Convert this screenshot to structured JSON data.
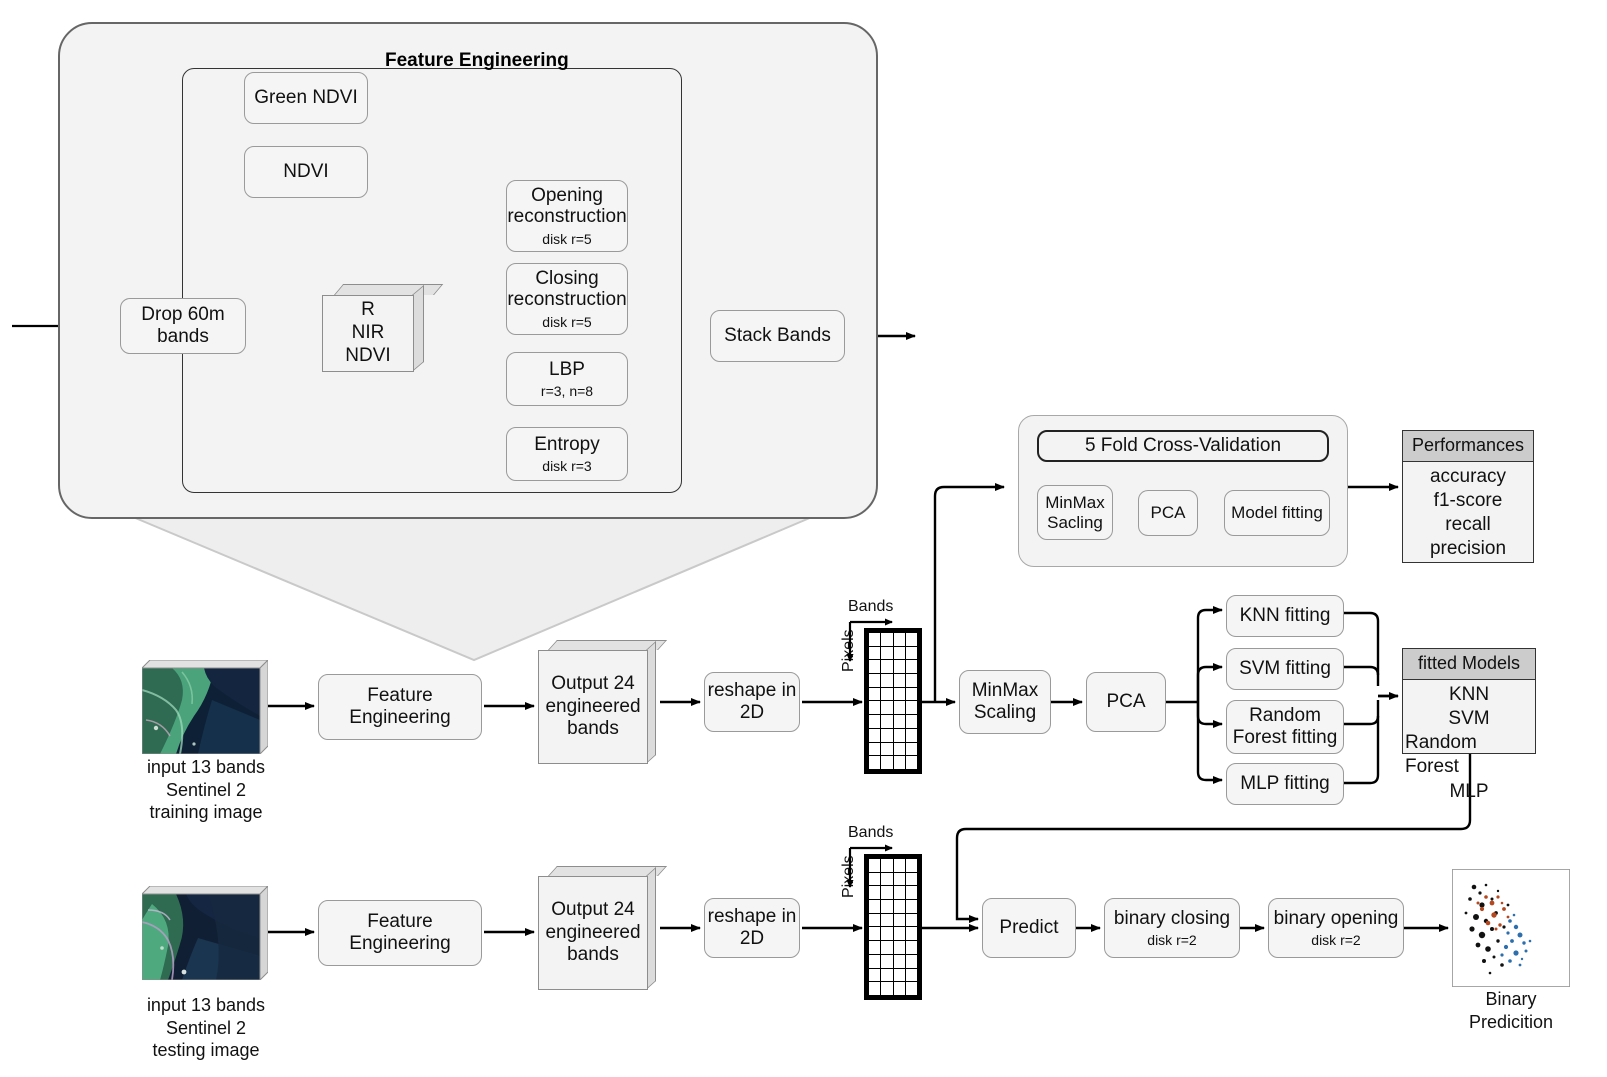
{
  "diagram": {
    "title": "Feature Engineering",
    "feature_engineering": {
      "group_title": "Feature Engineering",
      "nodes": {
        "drop60": {
          "line1": "Drop 60m",
          "line2": "bands"
        },
        "green_ndvi": {
          "label": "Green NDVI"
        },
        "ndvi": {
          "label": "NDVI"
        },
        "cube_rnirndvi": {
          "line1": "R",
          "line2": "NIR",
          "line3": "NDVI"
        },
        "opening": {
          "line1": "Opening",
          "line2": "reconstruction",
          "sub": "disk r=5"
        },
        "closing": {
          "line1": "Closing",
          "line2": "reconstruction",
          "sub": "disk r=5"
        },
        "lbp": {
          "line1": "LBP",
          "sub": "r=3, n=8"
        },
        "entropy": {
          "line1": "Entropy",
          "sub": "disk r=3"
        },
        "stack": {
          "label": "Stack Bands"
        }
      }
    },
    "cross_validation": {
      "header": "5 Fold Cross-Validation",
      "minmax": {
        "line1": "MinMax",
        "line2": "Sacling"
      },
      "pca": {
        "label": "PCA"
      },
      "model_fitting": {
        "label": "Model fitting"
      }
    },
    "performances": {
      "header": "Performances",
      "metrics": [
        "accuracy",
        "f1-score",
        "recall",
        "precision"
      ]
    },
    "fitted_models": {
      "header": "fitted Models",
      "models": [
        "KNN",
        "SVM",
        "Random Forest",
        "MLP"
      ]
    },
    "fitting_nodes": {
      "knn": {
        "label": "KNN fitting"
      },
      "svm": {
        "label": "SVM fitting"
      },
      "rf": {
        "line1": "Random",
        "line2": "Forest fitting"
      },
      "mlp": {
        "label": "MLP fitting"
      }
    },
    "training_row": {
      "input_caption": "input 13 bands\nSentinel 2\ntraining image",
      "feature_engineering": {
        "line1": "Feature",
        "line2": "Engineering"
      },
      "output": {
        "line1": "Output 24",
        "line2": "engineered",
        "line3": "bands"
      },
      "reshape": {
        "line1": "reshape in",
        "line2": "2D"
      },
      "matrix": {
        "bands_label": "Bands",
        "pixels_label": "Pixels",
        "cols": 4,
        "rows": 10
      },
      "minmax": {
        "line1": "MinMax",
        "line2": "Scaling"
      },
      "pca": {
        "label": "PCA"
      }
    },
    "testing_row": {
      "input_caption": "input 13 bands\nSentinel 2\ntesting image",
      "feature_engineering": {
        "line1": "Feature",
        "line2": "Engineering"
      },
      "output": {
        "line1": "Output 24",
        "line2": "engineered",
        "line3": "bands"
      },
      "reshape": {
        "line1": "reshape in",
        "line2": "2D"
      },
      "matrix": {
        "bands_label": "Bands",
        "pixels_label": "Pixels",
        "cols": 4,
        "rows": 10
      },
      "predict": {
        "label": "Predict"
      },
      "binary_closing": {
        "line1": "binary closing",
        "sub": "disk r=2"
      },
      "binary_opening": {
        "line1": "binary opening",
        "sub": "disk r=2"
      },
      "result_caption": "Binary\nPredicition"
    },
    "colors": {
      "node_fill": "#f5f5f5",
      "node_stroke": "#9a9a9a",
      "group_fill": "#f3f3f3",
      "group_stroke": "#666666",
      "header_fill": "#cccccc",
      "edge": "#000000"
    }
  }
}
